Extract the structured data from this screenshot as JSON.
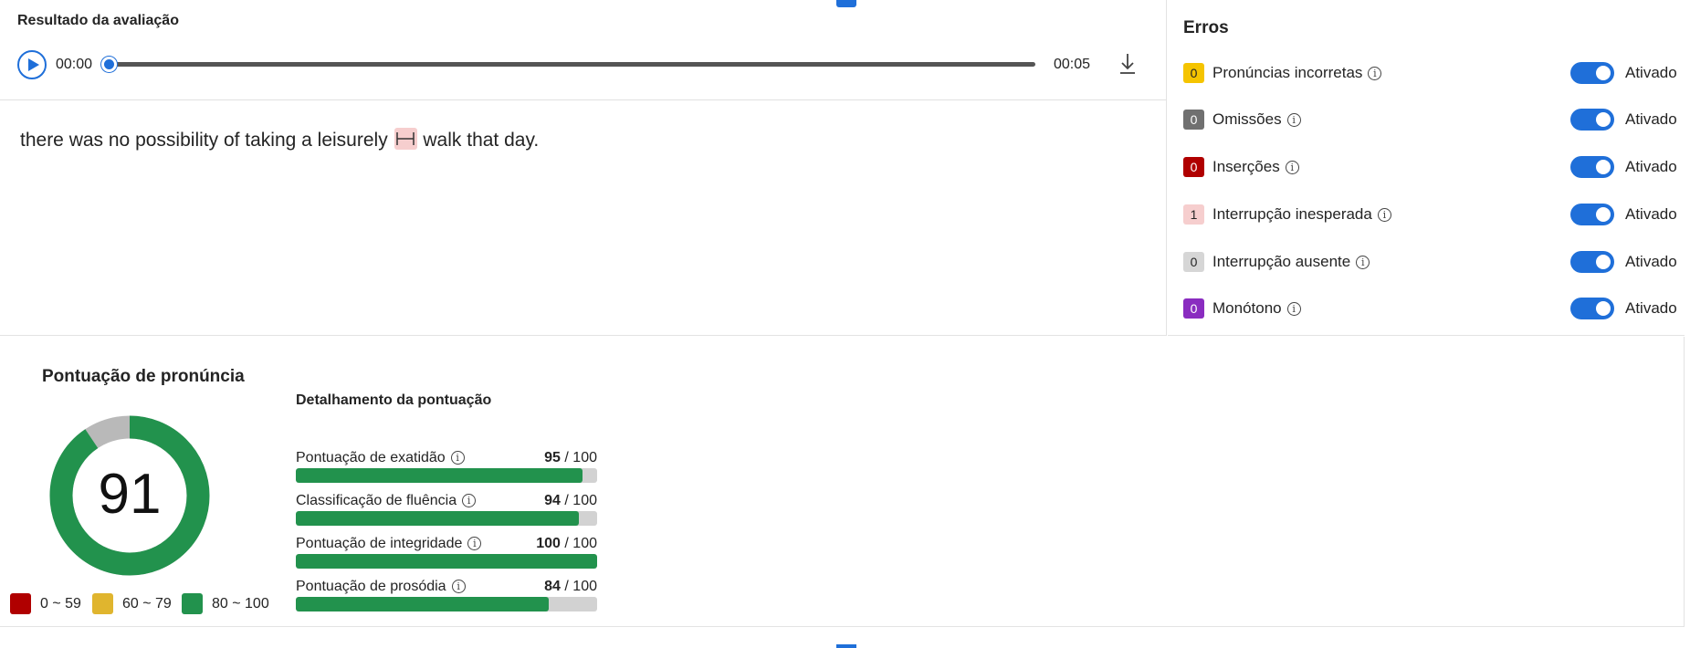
{
  "result": {
    "title": "Resultado da avaliação",
    "player": {
      "time_start": "00:00",
      "time_end": "00:05",
      "progress": 0,
      "play_icon": "play-icon",
      "download_icon": "download-icon"
    },
    "transcript": {
      "before": "there was no possibility of taking a leisurely",
      "after": "walk that day.",
      "break_marker": "unexpected-break-icon"
    }
  },
  "errors": {
    "title": "Erros",
    "toggle_label": "Ativado",
    "items": [
      {
        "count": "0",
        "label": "Pronúncias incorretas",
        "badge_color": "#f5c400",
        "text_color": "#242424",
        "enabled": true
      },
      {
        "count": "0",
        "label": "Omissões",
        "badge_color": "#707070",
        "text_color": "#ffffff",
        "enabled": true
      },
      {
        "count": "0",
        "label": "Inserções",
        "badge_color": "#b00000",
        "text_color": "#ffffff",
        "enabled": true
      },
      {
        "count": "1",
        "label": "Interrupção inesperada",
        "badge_color": "#f6cece",
        "text_color": "#242424",
        "enabled": true
      },
      {
        "count": "0",
        "label": "Interrupção ausente",
        "badge_color": "#d6d6d6",
        "text_color": "#242424",
        "enabled": true
      },
      {
        "count": "0",
        "label": "Monótono",
        "badge_color": "#8a2cc0",
        "text_color": "#ffffff",
        "enabled": true
      }
    ]
  },
  "score": {
    "title": "Pontuação de pronúncia",
    "value": "91",
    "max": 100,
    "ring_color": "#22924d",
    "ring_rest_color": "#b9b9b9",
    "legend": [
      {
        "label": "0 ~ 59",
        "color": "#b00000"
      },
      {
        "label": "60 ~ 79",
        "color": "#e0b52e"
      },
      {
        "label": "80 ~ 100",
        "color": "#22924d"
      }
    ]
  },
  "breakdown": {
    "title": "Detalhamento da pontuação",
    "max_label": "/ 100",
    "metrics": [
      {
        "label": "Pontuação de exatidão",
        "score": "95",
        "value": 95
      },
      {
        "label": "Classificação de fluência",
        "score": "94",
        "value": 94
      },
      {
        "label": "Pontuação de integridade",
        "score": "100",
        "value": 100
      },
      {
        "label": "Pontuação de prosódia",
        "score": "84",
        "value": 84
      }
    ]
  }
}
